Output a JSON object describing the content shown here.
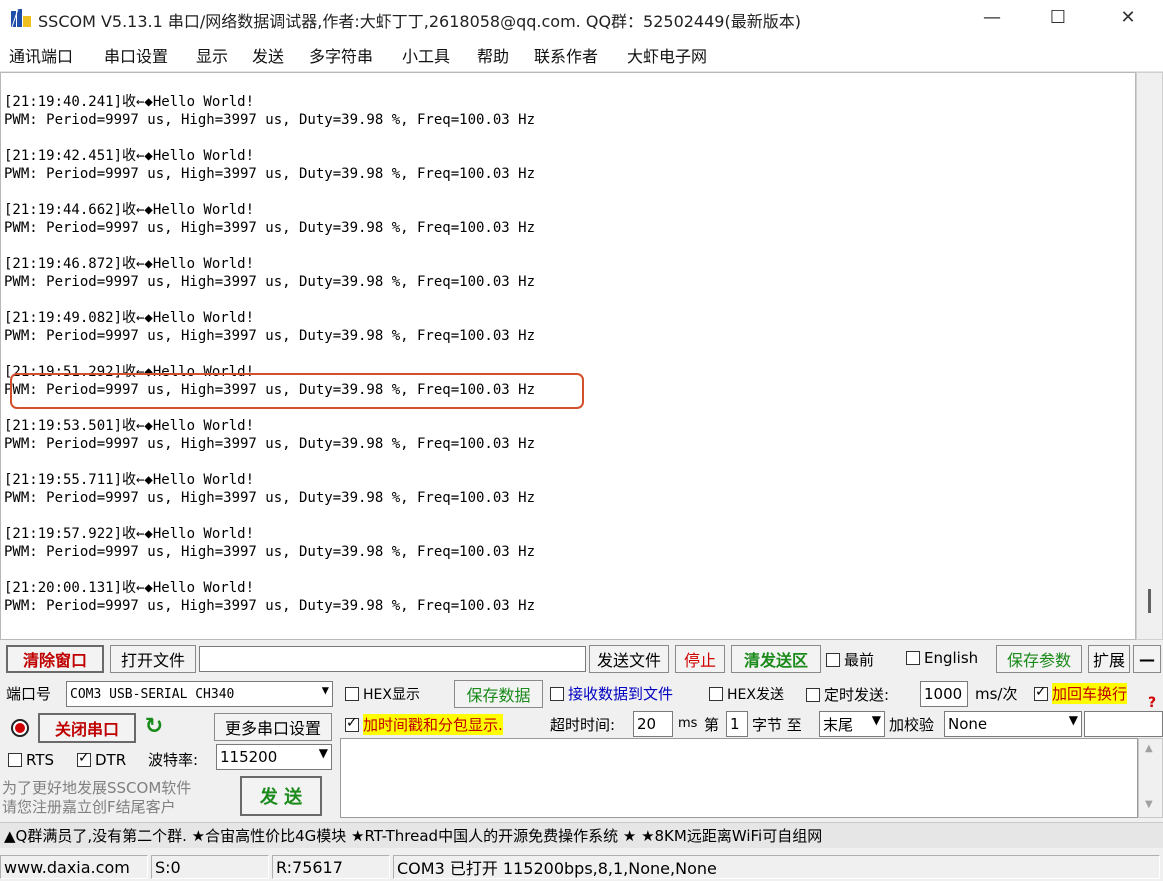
{
  "window": {
    "title": "SSCOM V5.13.1 串口/网络数据调试器,作者:大虾丁丁,2618058@qq.com. QQ群：52502449(最新版本)",
    "minimize": "—",
    "maximize": "☐",
    "close": "✕"
  },
  "menu": [
    "通讯端口",
    "串口设置",
    "显示",
    "发送",
    "多字符串",
    "小工具",
    "帮助",
    "联系作者",
    "大虾电子网"
  ],
  "receive": {
    "entries": [
      {
        "ts": "[21:19:40.241]收←◆Hello World!",
        "msg": "PWM: Period=9997 us, High=3997 us, Duty=39.98 %, Freq=100.03 Hz"
      },
      {
        "ts": "[21:19:42.451]收←◆Hello World!",
        "msg": "PWM: Period=9997 us, High=3997 us, Duty=39.98 %, Freq=100.03 Hz"
      },
      {
        "ts": "[21:19:44.662]收←◆Hello World!",
        "msg": "PWM: Period=9997 us, High=3997 us, Duty=39.98 %, Freq=100.03 Hz"
      },
      {
        "ts": "[21:19:46.872]收←◆Hello World!",
        "msg": "PWM: Period=9997 us, High=3997 us, Duty=39.98 %, Freq=100.03 Hz"
      },
      {
        "ts": "[21:19:49.082]收←◆Hello World!",
        "msg": "PWM: Period=9997 us, High=3997 us, Duty=39.98 %, Freq=100.03 Hz"
      },
      {
        "ts": "[21:19:51.292]收←◆Hello World!",
        "msg": "PWM: Period=9997 us, High=3997 us, Duty=39.98 %, Freq=100.03 Hz"
      },
      {
        "ts": "[21:19:53.501]收←◆Hello World!",
        "msg": "PWM: Period=9997 us, High=3997 us, Duty=39.98 %, Freq=100.03 Hz"
      },
      {
        "ts": "[21:19:55.711]收←◆Hello World!",
        "msg": "PWM: Period=9997 us, High=3997 us, Duty=39.98 %, Freq=100.03 Hz"
      },
      {
        "ts": "[21:19:57.922]收←◆Hello World!",
        "msg": "PWM: Period=9997 us, High=3997 us, Duty=39.98 %, Freq=100.03 Hz"
      },
      {
        "ts": "[21:20:00.131]收←◆Hello World!",
        "msg": "PWM: Period=9997 us, High=3997 us, Duty=39.98 %, Freq=100.03 Hz"
      }
    ],
    "highlighted_index": 5
  },
  "toolbar": {
    "clear_window": "清除窗口",
    "open_file": "打开文件",
    "file_path": "",
    "send_file": "发送文件",
    "stop": "停止",
    "clear_send": "清发送区",
    "topmost": "最前",
    "english": "English",
    "save_params": "保存参数",
    "expand": "扩展",
    "collapse": "—"
  },
  "port": {
    "port_label": "端口号",
    "port_value": "COM3 USB-SERIAL CH340",
    "close_port": "关闭串口",
    "more_settings": "更多串口设置",
    "rts": "RTS",
    "dtr": "DTR",
    "baud_label": "波特率:",
    "baud_value": "115200",
    "promo": "为了更好地发展SSCOM软件\n请您注册嘉立创F结尾客户",
    "send_button": "发  送"
  },
  "options": {
    "hex_display": "HEX显示",
    "save_data": "保存数据",
    "recv_to_file": "接收数据到文件",
    "hex_send": "HEX发送",
    "timed_send": "定时发送:",
    "interval_value": "1000",
    "interval_unit": "ms/次",
    "append_crlf": "加回车换行",
    "timestamp": "加时间戳和分包显示.",
    "timeout_label": "超时时间:",
    "timeout_value": "20",
    "timeout_unit": "ms",
    "byte_label_1": "第",
    "byte_index": "1",
    "byte_label_2": "字节 至",
    "byte_end": "末尾",
    "checksum_label": "加校验",
    "checksum_value": "None",
    "help": "?"
  },
  "ticker": "▲Q群满员了,没有第二个群. ★合宙高性价比4G模块 ★RT-Thread中国人的开源免费操作系统 ★ ★8KM远距离WiFi可自组网",
  "status": {
    "website": "www.daxia.com",
    "sent": "S:0",
    "received": "R:75617",
    "port_state": "COM3 已打开  115200bps,8,1,None,None"
  },
  "colors": {
    "highlight": "#d2502a",
    "clear_text": "#c00000",
    "save_green": "#1a8a1a",
    "crlf_bg": "#ffff00",
    "timestamp_bg": "#ffff00",
    "recv_file_blue": "#0000c0"
  }
}
